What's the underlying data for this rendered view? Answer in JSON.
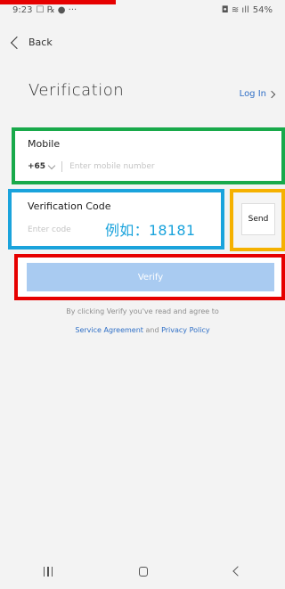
{
  "status_bar": {
    "time": "9:23",
    "left_icons": "☐ ℞ ● ···",
    "right_icons": "◘ ≋ ıll",
    "battery": "54%"
  },
  "nav": {
    "back_label": "Back"
  },
  "header": {
    "title": "Verification",
    "login_label": "Log In"
  },
  "mobile": {
    "label": "Mobile",
    "country_code": "+65",
    "placeholder": "Enter mobile number"
  },
  "verification": {
    "label": "Verification Code",
    "placeholder": "Enter code",
    "example_text": "例如：18181",
    "send_label": "Send"
  },
  "verify_button": {
    "label": "Verify"
  },
  "terms": {
    "text": "By clicking Verify you've read and agree to",
    "service_agreement": "Service Agreement",
    "and": "and",
    "privacy_policy": "Privacy Policy"
  },
  "colors": {
    "accent_link": "#2f6fc6",
    "verify_disabled": "#a9cbf1",
    "annotation_green": "#18a94a",
    "annotation_blue": "#1aa3dc",
    "annotation_yellow": "#f5b100",
    "annotation_red": "#e60000"
  }
}
